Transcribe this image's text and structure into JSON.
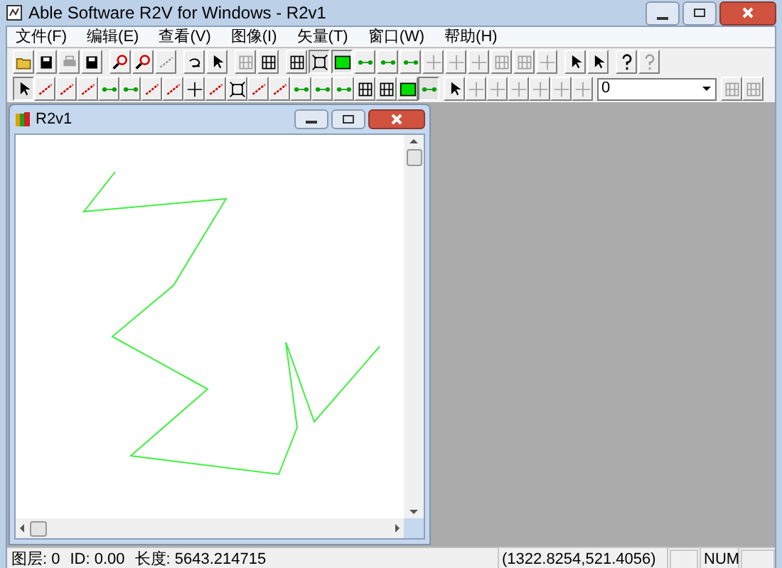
{
  "window": {
    "title": "Able Software R2V for Windows - R2v1"
  },
  "menu": [
    "文件(F)",
    "编辑(E)",
    "查看(V)",
    "图像(I)",
    "矢量(T)",
    "窗口(W)",
    "帮助(H)"
  ],
  "toolbars": [
    {
      "groups": [
        {
          "buttons": [
            {
              "kind": "folder",
              "disabled": false,
              "pressed": false
            },
            {
              "kind": "disk",
              "disabled": false,
              "pressed": false
            },
            {
              "kind": "printer",
              "disabled": true,
              "pressed": false
            },
            {
              "kind": "disk",
              "disabled": false,
              "pressed": false
            }
          ]
        },
        {
          "buttons": [
            {
              "kind": "magnifier",
              "disabled": false,
              "pressed": false
            },
            {
              "kind": "magnifier",
              "disabled": false,
              "pressed": false
            },
            {
              "kind": "line",
              "disabled": true,
              "pressed": false
            }
          ]
        },
        {
          "buttons": [
            {
              "kind": "undo",
              "disabled": false,
              "pressed": false
            },
            {
              "kind": "arrow",
              "disabled": false,
              "pressed": false
            }
          ]
        },
        {
          "buttons": [
            {
              "kind": "grid",
              "disabled": true,
              "pressed": false
            },
            {
              "kind": "grid",
              "disabled": false,
              "pressed": false
            }
          ]
        },
        {
          "buttons": [
            {
              "kind": "grid",
              "disabled": false,
              "pressed": false
            },
            {
              "kind": "frame",
              "disabled": false,
              "pressed": true
            },
            {
              "kind": "square",
              "disabled": false,
              "pressed": true
            },
            {
              "kind": "node",
              "disabled": false,
              "pressed": false
            },
            {
              "kind": "node",
              "disabled": false,
              "pressed": false
            },
            {
              "kind": "node",
              "disabled": false,
              "pressed": false
            },
            {
              "kind": "cross",
              "disabled": true,
              "pressed": false
            },
            {
              "kind": "cross",
              "disabled": true,
              "pressed": false
            },
            {
              "kind": "cross",
              "disabled": true,
              "pressed": false
            },
            {
              "kind": "grid",
              "disabled": true,
              "pressed": false
            },
            {
              "kind": "grid",
              "disabled": true,
              "pressed": false
            },
            {
              "kind": "cross",
              "disabled": true,
              "pressed": false
            }
          ]
        },
        {
          "buttons": [
            {
              "kind": "arrow",
              "disabled": false,
              "pressed": false
            },
            {
              "kind": "arrow",
              "disabled": false,
              "pressed": false
            }
          ]
        },
        {
          "buttons": [
            {
              "kind": "help",
              "disabled": false,
              "pressed": false
            },
            {
              "kind": "help",
              "disabled": true,
              "pressed": false
            }
          ]
        }
      ]
    },
    {
      "groups": [
        {
          "buttons": [
            {
              "kind": "arrow",
              "disabled": false,
              "pressed": true
            },
            {
              "kind": "line",
              "disabled": false,
              "pressed": false
            },
            {
              "kind": "line",
              "disabled": false,
              "pressed": false
            },
            {
              "kind": "line",
              "disabled": false,
              "pressed": false
            },
            {
              "kind": "node",
              "disabled": false,
              "pressed": false
            },
            {
              "kind": "node",
              "disabled": false,
              "pressed": false
            },
            {
              "kind": "line",
              "disabled": false,
              "pressed": false
            },
            {
              "kind": "line",
              "disabled": false,
              "pressed": false
            },
            {
              "kind": "cross",
              "disabled": false,
              "pressed": false
            },
            {
              "kind": "line",
              "disabled": false,
              "pressed": false
            },
            {
              "kind": "frame",
              "disabled": false,
              "pressed": false
            },
            {
              "kind": "line",
              "disabled": false,
              "pressed": false
            },
            {
              "kind": "line",
              "disabled": false,
              "pressed": false
            },
            {
              "kind": "node",
              "disabled": false,
              "pressed": false
            },
            {
              "kind": "node",
              "disabled": false,
              "pressed": false
            },
            {
              "kind": "node",
              "disabled": false,
              "pressed": false
            },
            {
              "kind": "grid",
              "disabled": false,
              "pressed": false
            },
            {
              "kind": "grid",
              "disabled": false,
              "pressed": false
            },
            {
              "kind": "square",
              "disabled": false,
              "pressed": false
            },
            {
              "kind": "node",
              "disabled": false,
              "pressed": true
            }
          ]
        },
        {
          "buttons": [
            {
              "kind": "arrow",
              "disabled": false,
              "pressed": false
            },
            {
              "kind": "cross",
              "disabled": true,
              "pressed": false
            },
            {
              "kind": "cross",
              "disabled": true,
              "pressed": false
            },
            {
              "kind": "cross",
              "disabled": true,
              "pressed": false
            },
            {
              "kind": "cross",
              "disabled": true,
              "pressed": false
            },
            {
              "kind": "cross",
              "disabled": true,
              "pressed": false
            },
            {
              "kind": "cross",
              "disabled": true,
              "pressed": false
            }
          ]
        }
      ]
    }
  ],
  "layer_select": {
    "value": "0"
  },
  "layer_buttons": [
    {
      "kind": "grid",
      "disabled": true,
      "pressed": false
    },
    {
      "kind": "grid",
      "disabled": true,
      "pressed": false
    }
  ],
  "child_window": {
    "title": "R2v1"
  },
  "status_bar": {
    "layer": "图层: 0",
    "id": "ID: 0.00",
    "length": "长度: 5643.214715",
    "coords": "(1322.8254,521.4056)",
    "num": "NUM"
  }
}
